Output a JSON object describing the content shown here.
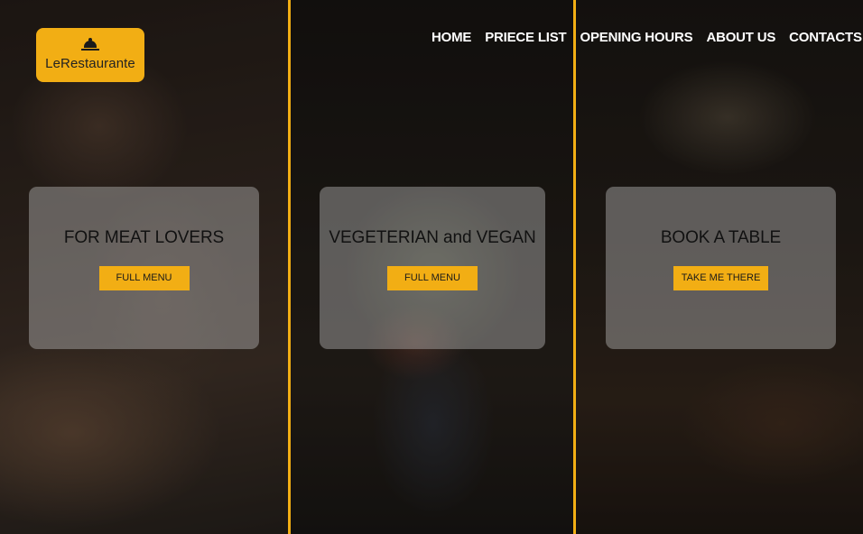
{
  "logo": {
    "text": "LeRestaurante",
    "icon": "cloche-icon"
  },
  "nav": {
    "items": [
      "HOME",
      "PRIECE LIST",
      "OPENING HOURS",
      "ABOUT US",
      "CONTACTS"
    ]
  },
  "cards": [
    {
      "title": "FOR MEAT LOVERS",
      "button": "FULL MENU"
    },
    {
      "title": "VEGETERIAN and VEGAN",
      "button": "FULL MENU"
    },
    {
      "title": "BOOK A TABLE",
      "button": "TAKE ME THERE"
    }
  ],
  "colors": {
    "accent": "#f2ae14",
    "card": "#bebebe",
    "nav_text": "#ffffff"
  }
}
